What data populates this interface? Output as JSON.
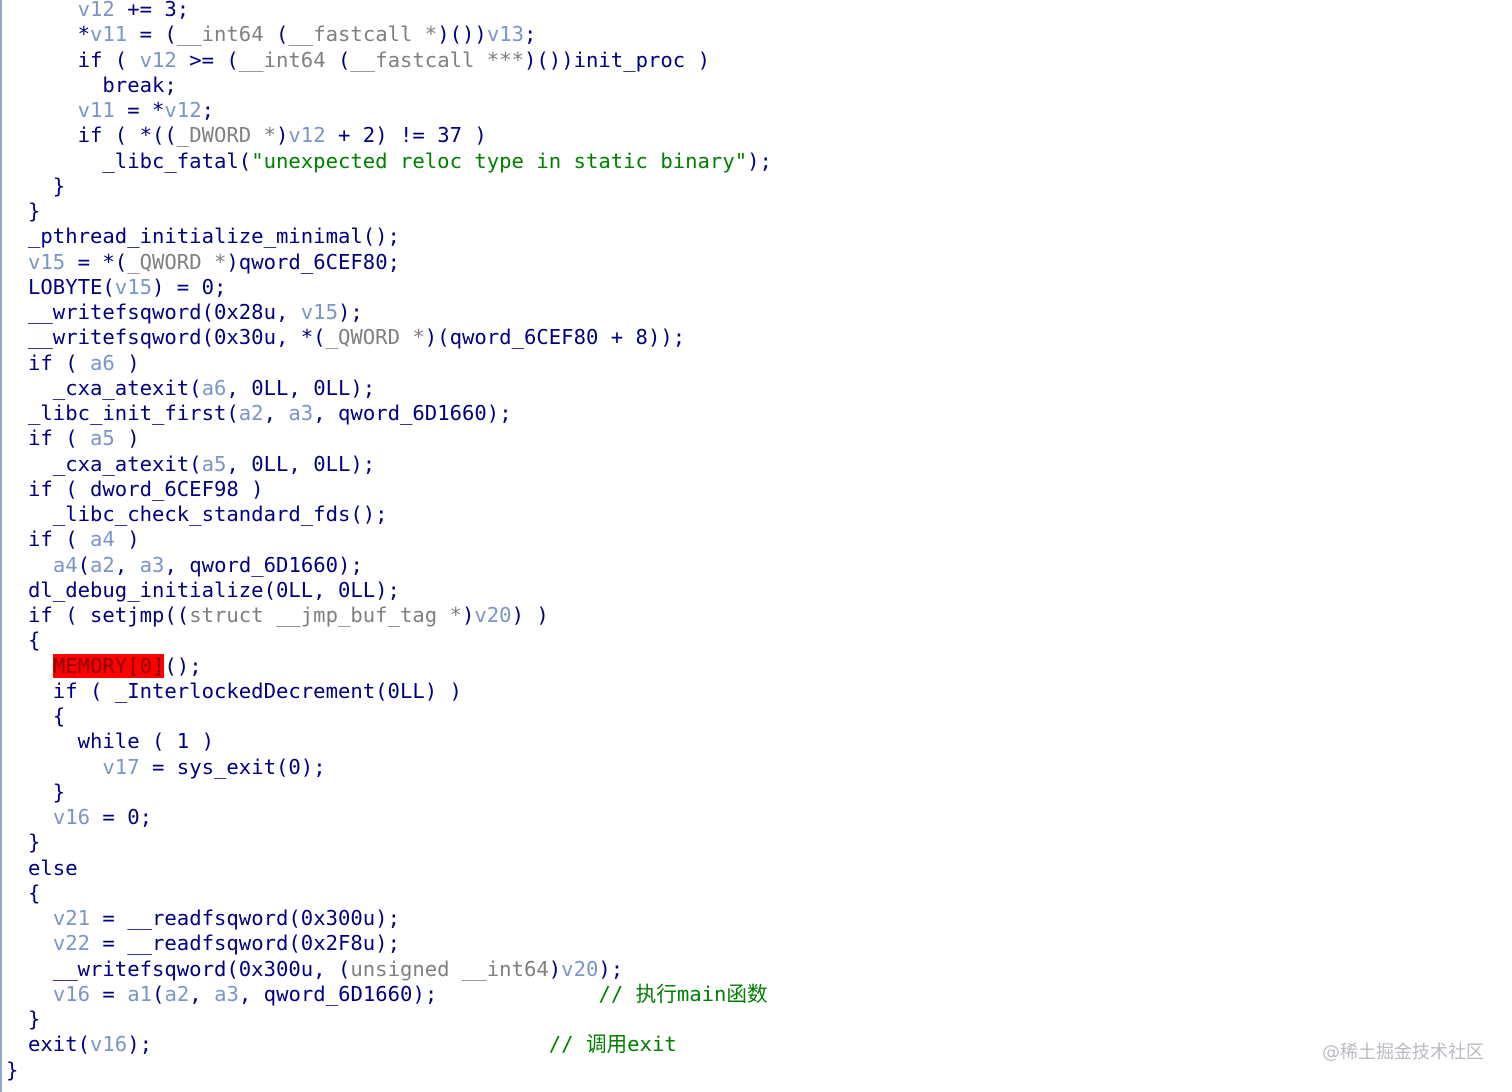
{
  "code_lines": [
    [
      {
        "t": "    "
      },
      {
        "t": "v12",
        "c": "v"
      },
      {
        "t": " += 3;"
      }
    ],
    [
      {
        "t": "    *"
      },
      {
        "t": "v11",
        "c": "v"
      },
      {
        "t": " = ("
      },
      {
        "t": "__int64 ",
        "c": "t"
      },
      {
        "t": "("
      },
      {
        "t": "__fastcall *",
        "c": "t"
      },
      {
        "t": ")())"
      },
      {
        "t": "v13",
        "c": "v"
      },
      {
        "t": ";"
      }
    ],
    [
      {
        "t": "    if ( "
      },
      {
        "t": "v12",
        "c": "v"
      },
      {
        "t": " >= ("
      },
      {
        "t": "__int64 ",
        "c": "t"
      },
      {
        "t": "("
      },
      {
        "t": "__fastcall ***",
        "c": "t"
      },
      {
        "t": ")())init_proc )"
      }
    ],
    [
      {
        "t": "      break;"
      }
    ],
    [
      {
        "t": "    "
      },
      {
        "t": "v11",
        "c": "v"
      },
      {
        "t": " = *"
      },
      {
        "t": "v12",
        "c": "v"
      },
      {
        "t": ";"
      }
    ],
    [
      {
        "t": "    if ( *(("
      },
      {
        "t": "_DWORD *",
        "c": "t"
      },
      {
        "t": ")"
      },
      {
        "t": "v12",
        "c": "v"
      },
      {
        "t": " + 2) != 37 )"
      }
    ],
    [
      {
        "t": "      _libc_fatal("
      },
      {
        "t": "\"unexpected reloc type in static binary\"",
        "c": "s"
      },
      {
        "t": ");"
      }
    ],
    [
      {
        "t": "  }"
      }
    ],
    [
      {
        "t": "}"
      }
    ],
    [
      {
        "t": "_pthread_initialize_minimal();"
      }
    ],
    [
      {
        "t": "v15",
        "c": "v"
      },
      {
        "t": " = *("
      },
      {
        "t": "_QWORD *",
        "c": "t"
      },
      {
        "t": ")qword_6CEF80;"
      }
    ],
    [
      {
        "t": "LOBYTE("
      },
      {
        "t": "v15",
        "c": "v"
      },
      {
        "t": ") = 0;"
      }
    ],
    [
      {
        "t": "__writefsqword(0x28u, "
      },
      {
        "t": "v15",
        "c": "v"
      },
      {
        "t": ");"
      }
    ],
    [
      {
        "t": "__writefsqword(0x30u, *("
      },
      {
        "t": "_QWORD *",
        "c": "t"
      },
      {
        "t": ")(qword_6CEF80 + 8));"
      }
    ],
    [
      {
        "t": "if ( "
      },
      {
        "t": "a6",
        "c": "v"
      },
      {
        "t": " )"
      }
    ],
    [
      {
        "t": "  _cxa_atexit("
      },
      {
        "t": "a6",
        "c": "v"
      },
      {
        "t": ", 0LL, 0LL);"
      }
    ],
    [
      {
        "t": "_libc_init_first("
      },
      {
        "t": "a2",
        "c": "v"
      },
      {
        "t": ", "
      },
      {
        "t": "a3",
        "c": "v"
      },
      {
        "t": ", qword_6D1660);"
      }
    ],
    [
      {
        "t": "if ( "
      },
      {
        "t": "a5",
        "c": "v"
      },
      {
        "t": " )"
      }
    ],
    [
      {
        "t": "  _cxa_atexit("
      },
      {
        "t": "a5",
        "c": "v"
      },
      {
        "t": ", 0LL, 0LL);"
      }
    ],
    [
      {
        "t": "if ( dword_6CEF98 )"
      }
    ],
    [
      {
        "t": "  _libc_check_standard_fds();"
      }
    ],
    [
      {
        "t": "if ( "
      },
      {
        "t": "a4",
        "c": "v"
      },
      {
        "t": " )"
      }
    ],
    [
      {
        "t": "  "
      },
      {
        "t": "a4",
        "c": "v"
      },
      {
        "t": "("
      },
      {
        "t": "a2",
        "c": "v"
      },
      {
        "t": ", "
      },
      {
        "t": "a3",
        "c": "v"
      },
      {
        "t": ", qword_6D1660);"
      }
    ],
    [
      {
        "t": "dl_debug_initialize(0LL, 0LL);"
      }
    ],
    [
      {
        "t": "if ( setjmp(("
      },
      {
        "t": "struct __jmp_buf_tag *",
        "c": "t"
      },
      {
        "t": ")"
      },
      {
        "t": "v20",
        "c": "v"
      },
      {
        "t": ") )"
      }
    ],
    [
      {
        "t": "{"
      }
    ],
    [
      {
        "t": "  "
      },
      {
        "t": "MEMORY[0]",
        "c": "hl"
      },
      {
        "t": "();"
      }
    ],
    [
      {
        "t": "  if ( _InterlockedDecrement(0LL) )"
      }
    ],
    [
      {
        "t": "  {"
      }
    ],
    [
      {
        "t": "    while ( 1 )"
      }
    ],
    [
      {
        "t": "      "
      },
      {
        "t": "v17",
        "c": "v"
      },
      {
        "t": " = sys_exit(0);"
      }
    ],
    [
      {
        "t": "  }"
      }
    ],
    [
      {
        "t": "  "
      },
      {
        "t": "v16",
        "c": "v"
      },
      {
        "t": " = 0;"
      }
    ],
    [
      {
        "t": "}"
      }
    ],
    [
      {
        "t": "else"
      }
    ],
    [
      {
        "t": "{"
      }
    ],
    [
      {
        "t": "  "
      },
      {
        "t": "v21",
        "c": "v"
      },
      {
        "t": " = __readfsqword(0x300u);"
      }
    ],
    [
      {
        "t": "  "
      },
      {
        "t": "v22",
        "c": "v"
      },
      {
        "t": " = __readfsqword(0x2F8u);"
      }
    ],
    [
      {
        "t": "  __writefsqword(0x300u, ("
      },
      {
        "t": "unsigned __int64",
        "c": "t"
      },
      {
        "t": ")"
      },
      {
        "t": "v20",
        "c": "v"
      },
      {
        "t": ");"
      }
    ],
    [
      {
        "t": "  "
      },
      {
        "t": "v16",
        "c": "v"
      },
      {
        "t": " = "
      },
      {
        "t": "a1",
        "c": "v"
      },
      {
        "t": "("
      },
      {
        "t": "a2",
        "c": "v"
      },
      {
        "t": ", "
      },
      {
        "t": "a3",
        "c": "v"
      },
      {
        "t": ", qword_6D1660);             "
      },
      {
        "t": "// 执行main函数",
        "c": "c"
      }
    ],
    [
      {
        "t": "}"
      }
    ],
    [
      {
        "t": "exit("
      },
      {
        "t": "v16",
        "c": "v"
      },
      {
        "t": ");                                "
      },
      {
        "t": "// 调用exit",
        "c": "c"
      }
    ],
    [
      {
        "t": "}"
      }
    ]
  ],
  "watermark": "@稀土掘金技术社区",
  "colors": {
    "keyword": "#000080",
    "variable": "#7a96c8",
    "type": "#808080",
    "string": "#008000",
    "comment": "#008000",
    "highlight_bg": "#ff0000"
  }
}
